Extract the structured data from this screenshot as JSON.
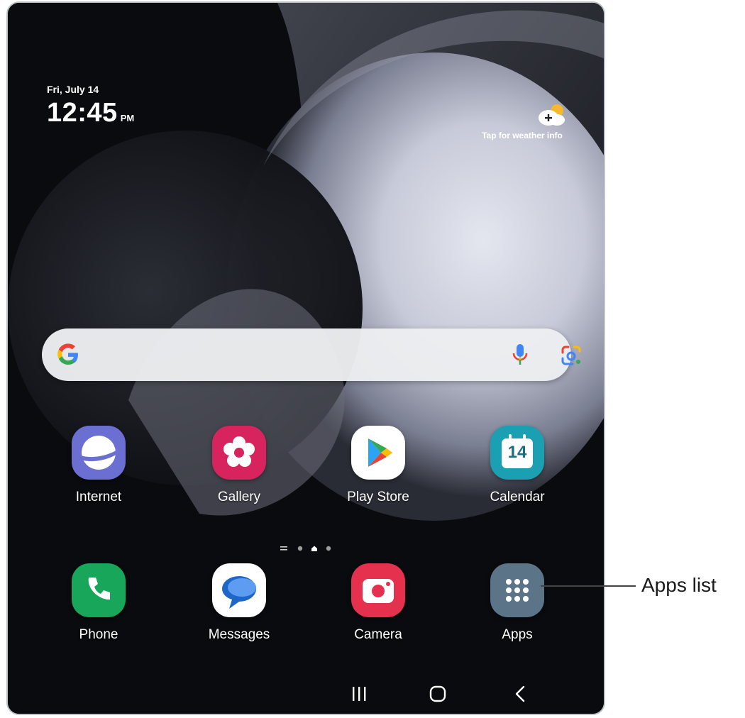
{
  "status": {
    "date": "Fri, July 14",
    "time": "12:45",
    "ampm": "PM"
  },
  "weather": {
    "label": "Tap for weather info",
    "icon": "weather-add-icon"
  },
  "search": {
    "logo": "google-g-icon",
    "mic": "mic-icon",
    "lens": "lens-icon"
  },
  "apps_row1": [
    {
      "label": "Internet",
      "icon": "internet-icon",
      "color": "#6a6fd1"
    },
    {
      "label": "Gallery",
      "icon": "gallery-icon",
      "color": "#d8245e"
    },
    {
      "label": "Play Store",
      "icon": "play-store-icon",
      "color": "#ffffff"
    },
    {
      "label": "Calendar",
      "icon": "calendar-icon",
      "color": "#1b9fb3",
      "day": "14"
    }
  ],
  "dock": [
    {
      "label": "Phone",
      "icon": "phone-icon",
      "color": "#18a75a"
    },
    {
      "label": "Messages",
      "icon": "messages-icon",
      "color": "#ffffff"
    },
    {
      "label": "Camera",
      "icon": "camera-icon",
      "color": "#e5304e"
    },
    {
      "label": "Apps",
      "icon": "apps-grid-icon",
      "color": "#5b7488"
    }
  ],
  "pager": {
    "pages": 4,
    "current": 3
  },
  "navbar": {
    "recents": "recents-icon",
    "home": "home-icon",
    "back": "back-icon"
  },
  "callout": {
    "text": "Apps list"
  }
}
